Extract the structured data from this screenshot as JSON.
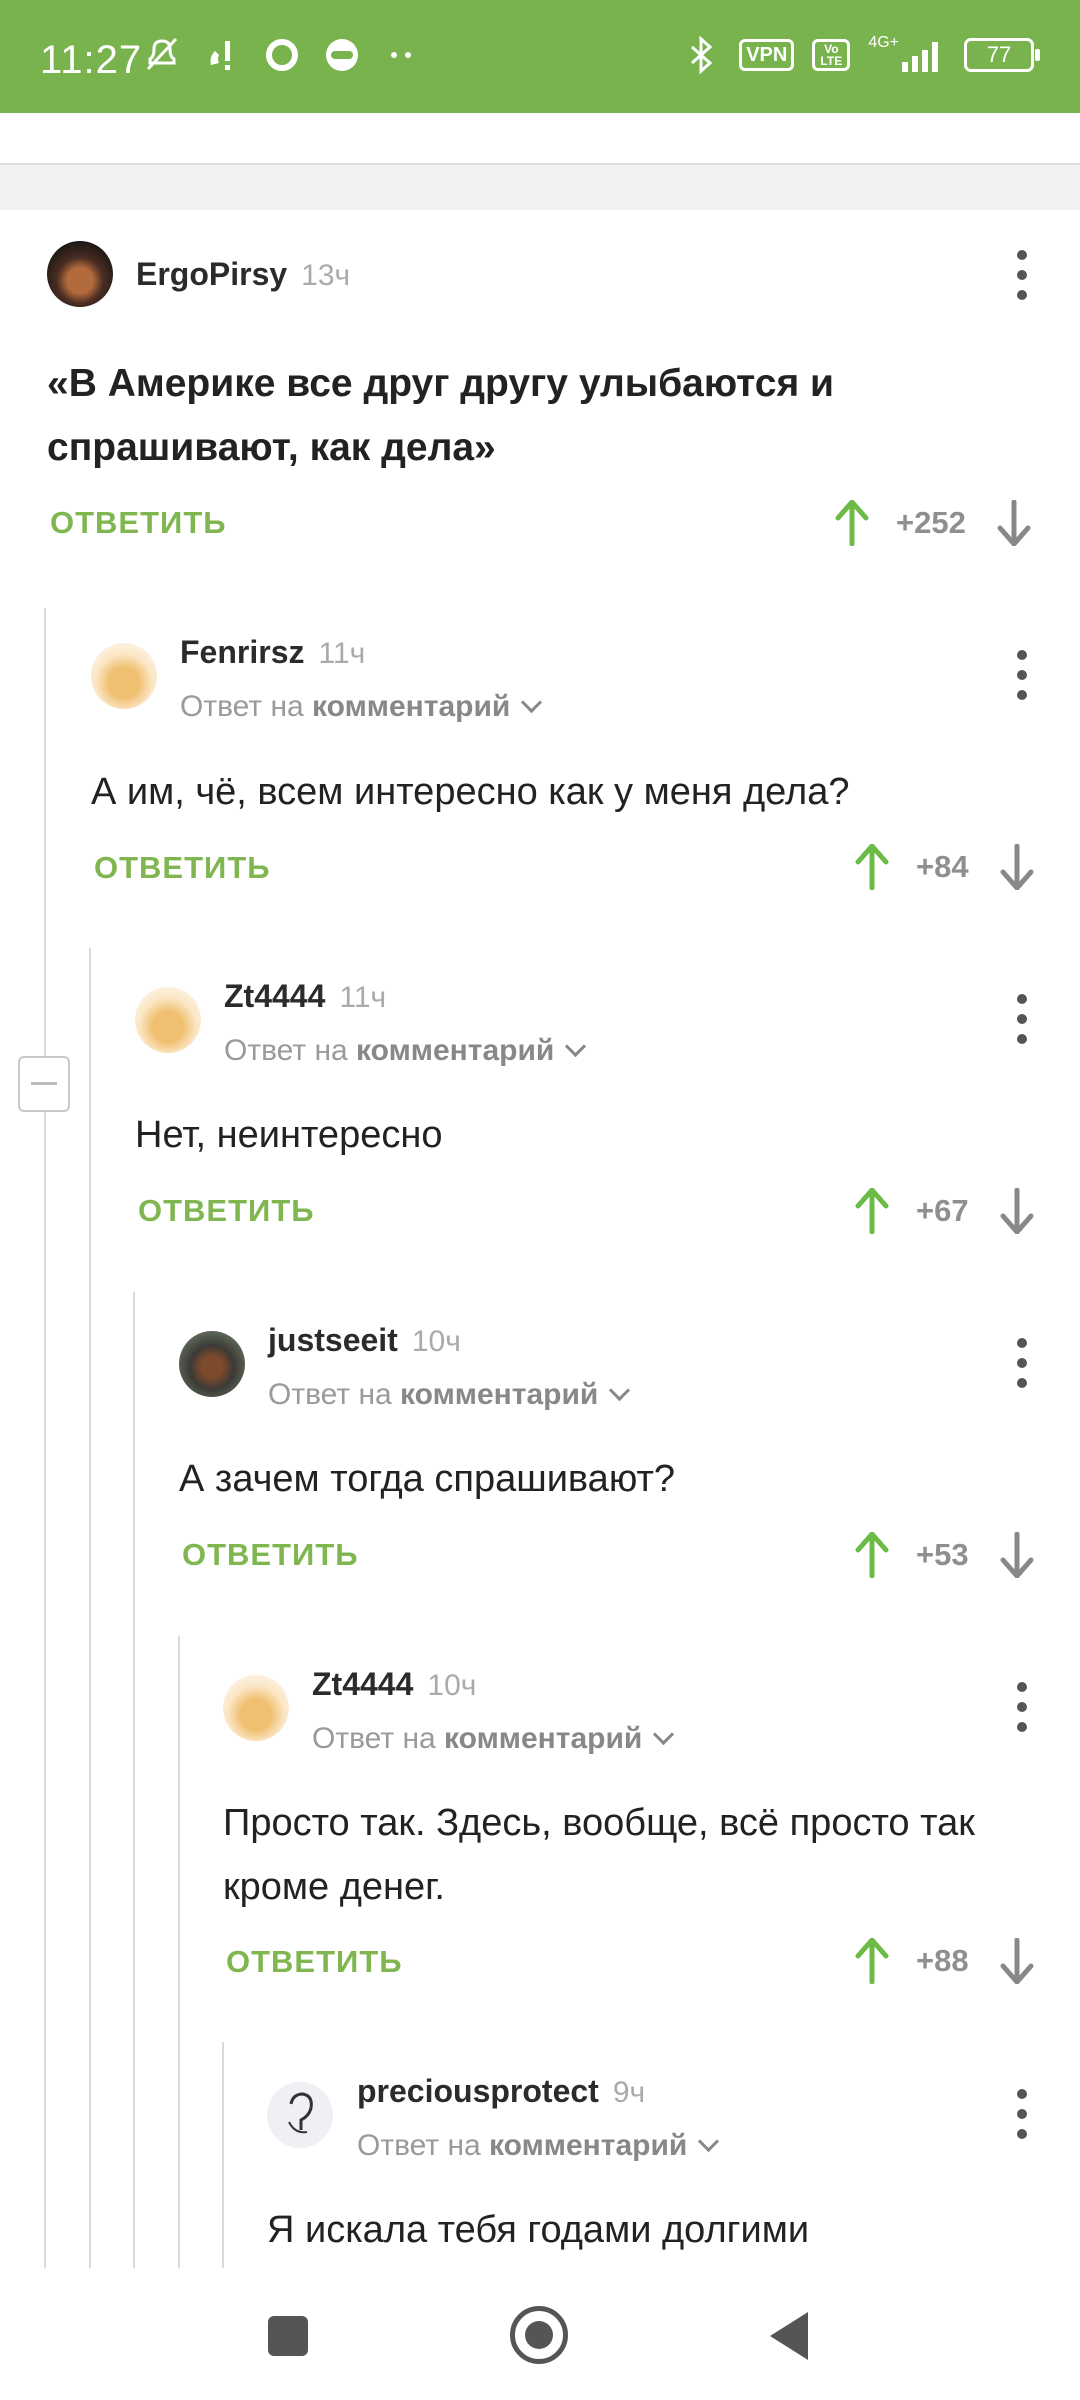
{
  "status_bar": {
    "time": "11:27",
    "left_icons": [
      "mute-icon",
      "wifi-call-icon",
      "circle-icon",
      "face-icon",
      "more-dots-icon"
    ],
    "vpn": "VPN",
    "volte": "Vo LTE",
    "network": "4G+",
    "battery": "77"
  },
  "colors": {
    "accent": "#79b34d",
    "reply": "#7fb64f",
    "upvote": "#6dbb46",
    "downvote": "#888888"
  },
  "comments": [
    {
      "author": "ErgoPirsy",
      "time": "13ч",
      "text": "«В Америке все друг другу улыбаются и спрашивают, как дела»",
      "reply_label": "ОТВЕТИТЬ",
      "rating": "+252"
    },
    {
      "author": "Fenrirsz",
      "time": "11ч",
      "reply_prefix": "Ответ на",
      "reply_target": "комментарий",
      "text": "А им, чё, всем интересно как у меня дела?",
      "reply_label": "ОТВЕТИТЬ",
      "rating": "+84"
    },
    {
      "author": "Zt4444",
      "time": "11ч",
      "reply_prefix": "Ответ на",
      "reply_target": "комментарий",
      "text": "Нет, неинтересно",
      "reply_label": "ОТВЕТИТЬ",
      "rating": "+67"
    },
    {
      "author": "justseeit",
      "time": "10ч",
      "reply_prefix": "Ответ на",
      "reply_target": "комментарий",
      "text": "А зачем тогда спрашивают?",
      "reply_label": "ОТВЕТИТЬ",
      "rating": "+53"
    },
    {
      "author": "Zt4444",
      "time": "10ч",
      "reply_prefix": "Ответ на",
      "reply_target": "комментарий",
      "text": "Просто так. Здесь, вообще, всё просто так кроме денег.",
      "reply_label": "ОТВЕТИТЬ",
      "rating": "+88"
    },
    {
      "author": "preciousprotect",
      "time": "9ч",
      "reply_prefix": "Ответ на",
      "reply_target": "комментарий",
      "text": "Я искала тебя годами долгими"
    }
  ]
}
